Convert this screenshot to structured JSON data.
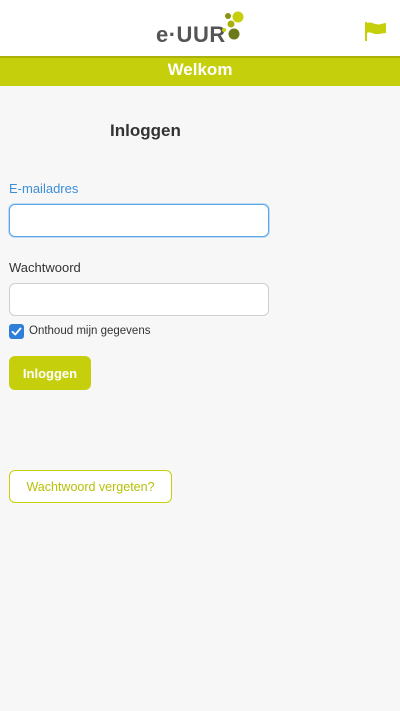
{
  "header": {
    "logo_text": "e·UUR",
    "language_icon": "flag-icon",
    "brand_color": "#c6cf0c",
    "logo_text_color": "#555555",
    "logo_dot_colors": [
      "#c6cf0c",
      "#8a9210",
      "#6c7a1a"
    ]
  },
  "banner": {
    "title": "Welkom"
  },
  "form": {
    "title": "Inloggen",
    "email_label": "E-mailadres",
    "email_value": "",
    "password_label": "Wachtwoord",
    "password_value": "",
    "remember_label": "Onthoud mijn gegevens",
    "remember_checked": true,
    "login_button": "Inloggen",
    "forgot_button": "Wachtwoord vergeten?"
  },
  "colors": {
    "accent": "#c6cf0c",
    "focus": "#5aa6e8",
    "checkbox": "#2f7fd8",
    "label_active": "#3b8fd6"
  }
}
